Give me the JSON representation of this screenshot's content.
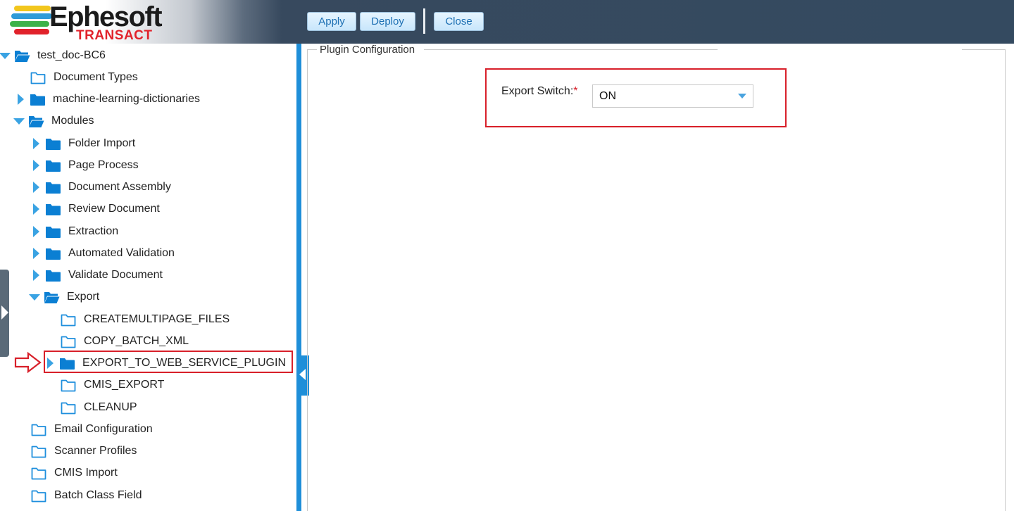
{
  "header": {
    "logo_name": "Ephesoft",
    "logo_sub": "TRANSACT",
    "buttons": {
      "apply": "Apply",
      "deploy": "Deploy",
      "close": "Close"
    }
  },
  "tree": {
    "root": "test_doc-BC6",
    "items": {
      "document_types": "Document Types",
      "ml_dictionaries": "machine-learning-dictionaries",
      "modules": "Modules",
      "folder_import": "Folder Import",
      "page_process": "Page Process",
      "document_assembly": "Document Assembly",
      "review_document": "Review Document",
      "extraction": "Extraction",
      "automated_validation": "Automated Validation",
      "validate_document": "Validate Document",
      "export": "Export",
      "createmultipage_files": "CREATEMULTIPAGE_FILES",
      "copy_batch_xml": "COPY_BATCH_XML",
      "export_to_web_service_plugin": "EXPORT_TO_WEB_SERVICE_PLUGIN",
      "cmis_export": "CMIS_EXPORT",
      "cleanup": "CLEANUP",
      "email_configuration": "Email Configuration",
      "scanner_profiles": "Scanner Profiles",
      "cmis_import": "CMIS Import",
      "batch_class_field": "Batch Class Field"
    }
  },
  "panel": {
    "legend": "Plugin Configuration",
    "export_switch_label": "Export Switch:",
    "required_marker": "*",
    "export_switch_value": "ON"
  },
  "colors": {
    "header_bg": "#344a60",
    "accent_blue": "#1f8fd9",
    "highlight_red": "#d8202a",
    "tree_arrow": "#3aa3e3",
    "folder": "#0b7fd3"
  }
}
